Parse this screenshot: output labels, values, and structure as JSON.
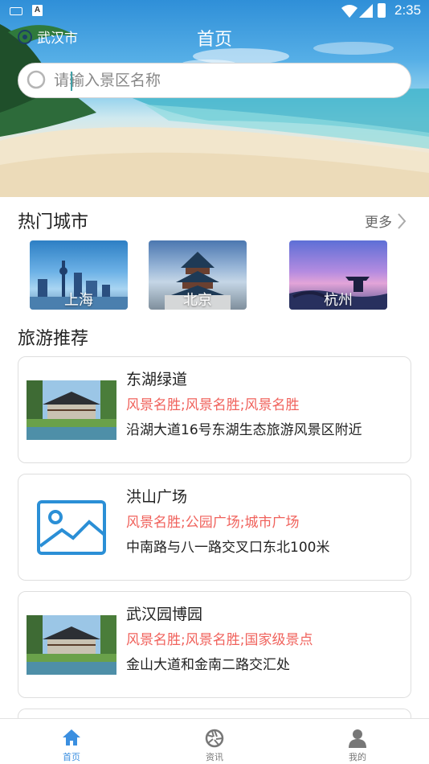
{
  "status_bar": {
    "time": "2:35",
    "a_badge": "A"
  },
  "header": {
    "location": "武汉市",
    "title": "首页"
  },
  "search": {
    "placeholder": "请输入景区名称",
    "value": ""
  },
  "hot_cities": {
    "title": "热门城市",
    "more_label": "更多",
    "cities": [
      {
        "name": "上海"
      },
      {
        "name": "北京"
      },
      {
        "name": "杭州"
      }
    ]
  },
  "recommend": {
    "title": "旅游推荐",
    "items": [
      {
        "name": "东湖绿道",
        "tags": "风景名胜;风景名胜;风景名胜",
        "address": "沿湖大道16号东湖生态旅游风景区附近",
        "thumb": "pavilion-photo"
      },
      {
        "name": "洪山广场",
        "tags": "风景名胜;公园广场;城市广场",
        "address": "中南路与八一路交叉口东北100米",
        "thumb": "image-placeholder-icon"
      },
      {
        "name": "武汉园博园",
        "tags": "风景名胜;风景名胜;国家级景点",
        "address": "金山大道和金南二路交汇处",
        "thumb": "pavilion-photo"
      }
    ]
  },
  "bottom_nav": {
    "items": [
      {
        "label": "首页",
        "icon": "home-icon",
        "active": true
      },
      {
        "label": "资讯",
        "icon": "aperture-icon",
        "active": false
      },
      {
        "label": "我的",
        "icon": "person-icon",
        "active": false
      }
    ]
  },
  "colors": {
    "accent": "#3b8fe0",
    "tag_red": "#f0625c",
    "placeholder_blue": "#2b8fd6"
  }
}
